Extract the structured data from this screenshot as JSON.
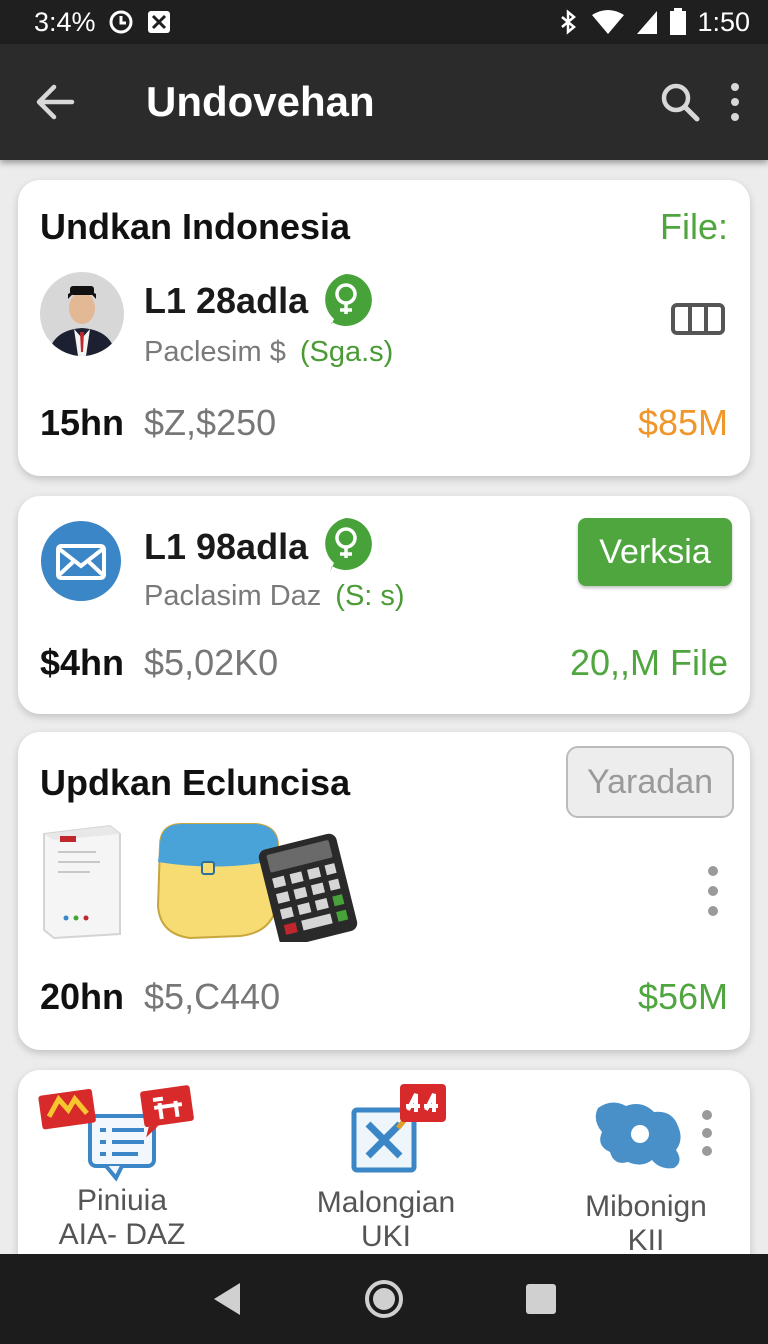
{
  "status_bar": {
    "left_text": "3:4%",
    "time": "1:50",
    "icons": [
      "clock-icon",
      "notification-x-icon",
      "bluetooth-icon",
      "wifi-icon",
      "signal-icon",
      "battery-icon"
    ]
  },
  "app_bar": {
    "title": "Undovehan",
    "icons": [
      "back-arrow-icon",
      "search-icon",
      "overflow-menu-icon"
    ]
  },
  "cards": [
    {
      "title": "Undkan Indonesia",
      "corner_label": "File:",
      "name": "L1 28adla",
      "subtitle": "Paclesim $",
      "code": "(Sga.s)",
      "period": "15hn",
      "price": "$Z,$250",
      "total": "$85M"
    },
    {
      "name": "L1 98adla",
      "subtitle": "Paclasim Daz",
      "code": "(S: s)",
      "button": "Verksia",
      "period": "$4hn",
      "price": "$5,02K0",
      "total": "20,,M File"
    },
    {
      "title": "Updkan Ecluncisa",
      "button": "Yaradan",
      "period": "20hn",
      "price": "$5,C440",
      "total": "$56M"
    }
  ],
  "shortcuts": [
    {
      "line1": "Piniuia",
      "line2": "AIA- DAZ",
      "icon": "chat-list-icon"
    },
    {
      "line1": "Malongian",
      "line2": "UKI",
      "icon": "x-box-icon"
    },
    {
      "line1": "Mibonign",
      "line2": "KII",
      "icon": "map-icon"
    }
  ],
  "colors": {
    "green": "#4fa63f",
    "orange": "#f0962a",
    "appbar": "#2b2b2b",
    "status": "#1f1f1f"
  }
}
